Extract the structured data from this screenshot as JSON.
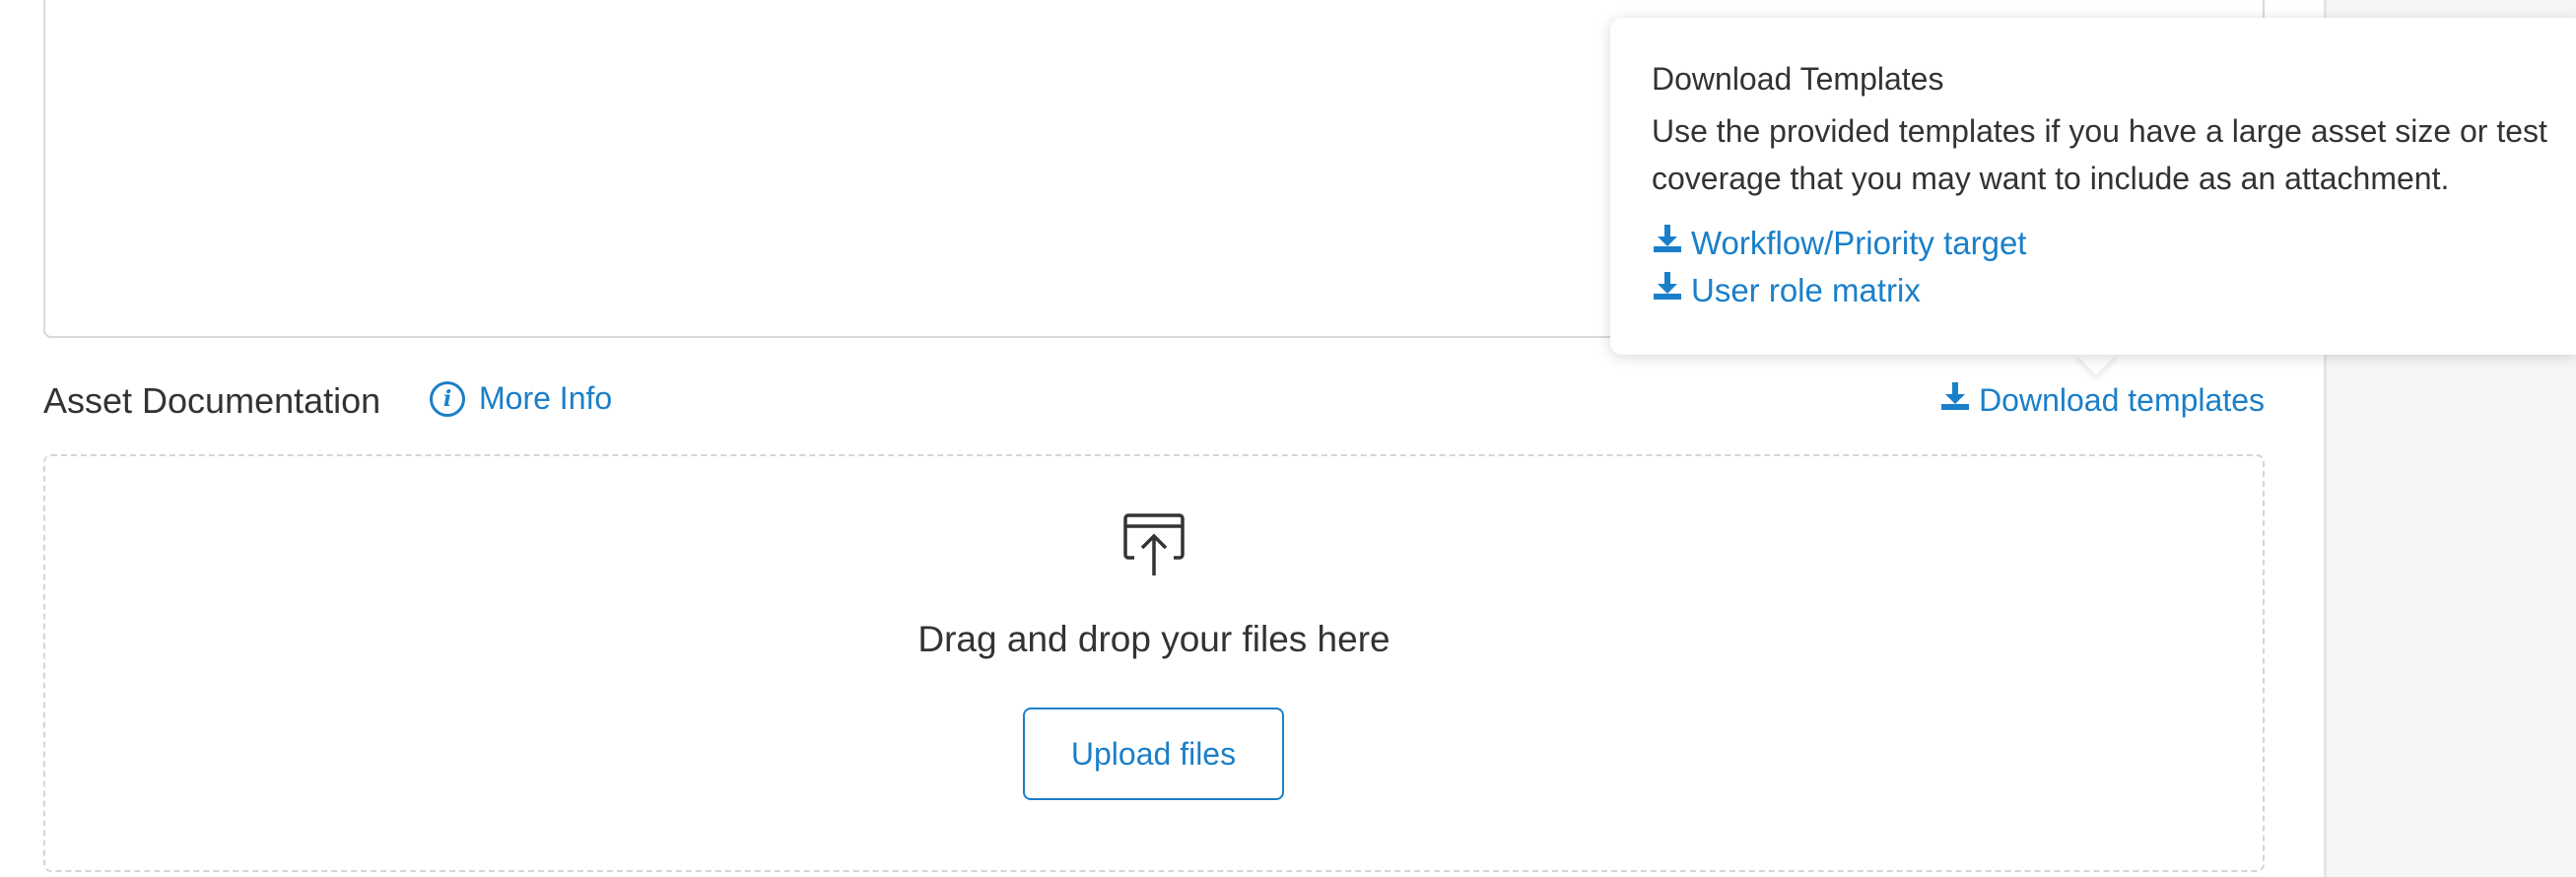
{
  "section": {
    "title": "Asset Documentation",
    "more_info_label": "More Info",
    "download_templates_label": "Download templates"
  },
  "dropzone": {
    "text": "Drag and drop your files here",
    "upload_button_label": "Upload files"
  },
  "popover": {
    "title": "Download Templates",
    "body": "Use the provided templates if you have a large asset size or test coverage that you may want to include as an attachment.",
    "templates": [
      {
        "label": "Workflow/Priority target"
      },
      {
        "label": "User role matrix"
      }
    ]
  },
  "icons": {
    "info": "info-icon",
    "download": "download-icon",
    "upload": "upload-icon"
  },
  "colors": {
    "accent": "#1a7fc9",
    "text": "#333333",
    "border": "#d5d5d5",
    "panel": "#f6f6f6"
  }
}
